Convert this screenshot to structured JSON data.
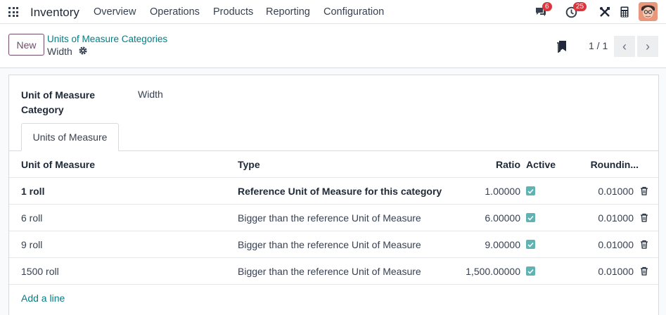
{
  "navbar": {
    "app_name": "Inventory",
    "menus": [
      "Overview",
      "Operations",
      "Products",
      "Reporting",
      "Configuration"
    ],
    "messages_badge": "6",
    "activities_badge": "25",
    "icons": [
      "apps-grid-icon",
      "chat-icon",
      "clock-icon",
      "tools-icon",
      "calculator-icon",
      "user-avatar"
    ]
  },
  "control": {
    "new_label": "New",
    "breadcrumb_parent": "Units of Measure Categories",
    "breadcrumb_current": "Width",
    "pager": "1 / 1"
  },
  "form": {
    "field_label": "Unit of Measure Category",
    "field_value": "Width",
    "tab_label": "Units of Measure"
  },
  "table": {
    "headers": {
      "uom": "Unit of Measure",
      "type": "Type",
      "ratio": "Ratio",
      "active": "Active",
      "rounding": "Roundin..."
    },
    "rows": [
      {
        "uom": "1 roll",
        "type": "Reference Unit of Measure for this category",
        "ratio": "1.00000",
        "active": true,
        "rounding": "0.01000"
      },
      {
        "uom": "6 roll",
        "type": "Bigger than the reference Unit of Measure",
        "ratio": "6.00000",
        "active": true,
        "rounding": "0.01000"
      },
      {
        "uom": "9 roll",
        "type": "Bigger than the reference Unit of Measure",
        "ratio": "9.00000",
        "active": true,
        "rounding": "0.01000"
      },
      {
        "uom": "1500 roll",
        "type": "Bigger than the reference Unit of Measure",
        "ratio": "1,500.00000",
        "active": true,
        "rounding": "0.01000"
      }
    ],
    "add_line": "Add a line"
  },
  "colors": {
    "primary": "#714b67",
    "link": "#017e84",
    "badge": "#d9363e",
    "checkbox": "#5fb3b3"
  }
}
